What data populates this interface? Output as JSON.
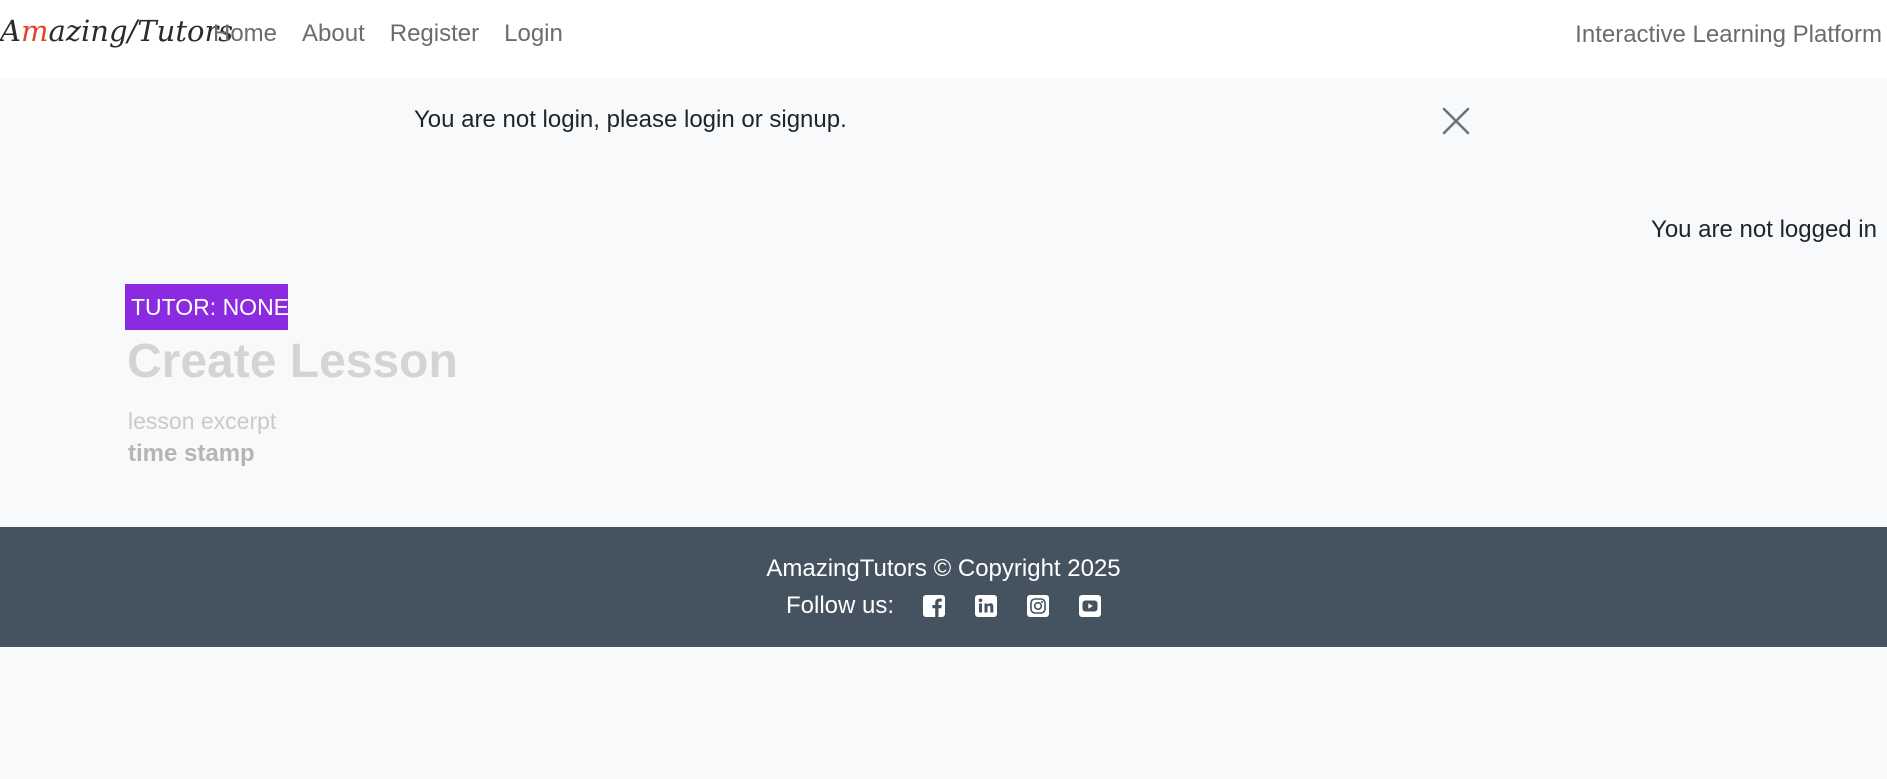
{
  "navbar": {
    "brand_first": "A",
    "brand_accent": "m",
    "brand_rest": "azing/Tutors",
    "links": [
      "Home",
      "About",
      "Register",
      "Login"
    ],
    "tagline": "Interactive Learning Platform"
  },
  "alert": {
    "message": "You are not login, please login or signup.",
    "close_icon": "close-icon"
  },
  "status": {
    "login_text": "You are not logged in"
  },
  "lesson": {
    "tutor_badge": "TUTOR: NONE",
    "title": "Create Lesson",
    "excerpt": "lesson excerpt",
    "timestamp": "time stamp"
  },
  "footer": {
    "copyright": "AmazingTutors © Copyright 2025",
    "follow_label": "Follow us:",
    "social_icons": [
      "facebook-icon",
      "linkedin-icon",
      "instagram-icon",
      "youtube-icon"
    ]
  },
  "colors": {
    "brand_accent": "#e0452a",
    "badge": "#8a2be2",
    "footer_bg": "#45525f",
    "page_bg": "#f8f9fa"
  }
}
